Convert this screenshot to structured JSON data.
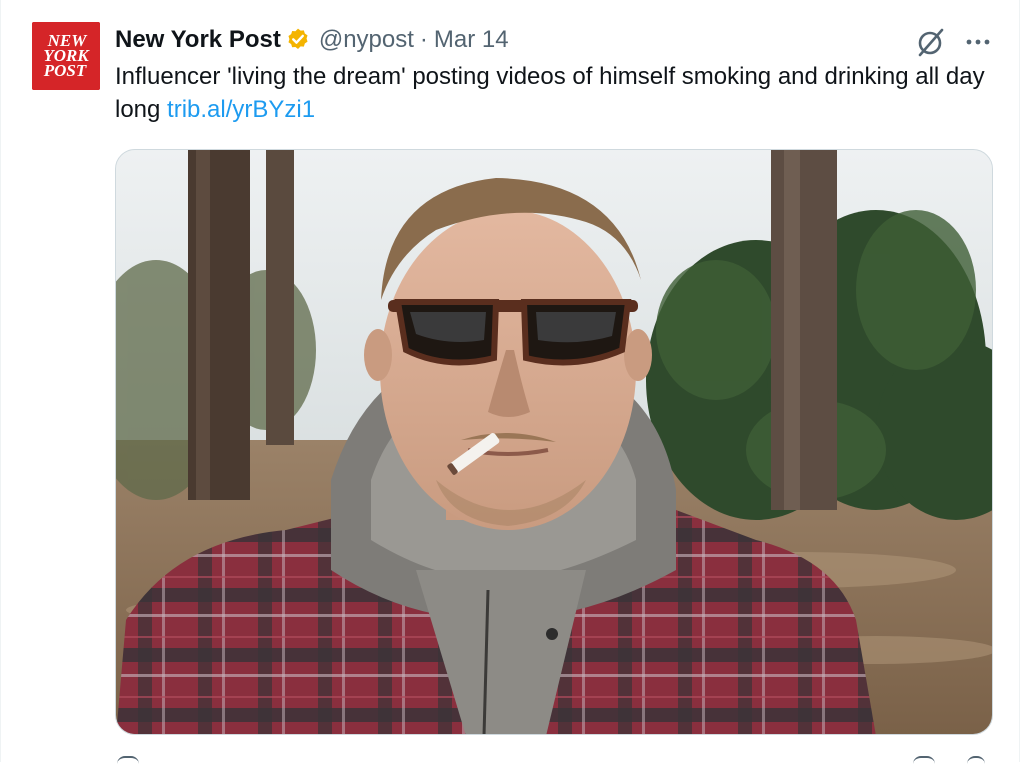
{
  "tweet": {
    "author": {
      "display_name": "New York Post",
      "handle": "@nypost",
      "verified": true,
      "verified_color": "#f4b400",
      "avatar_text": [
        "NEW",
        "YORK",
        "POST"
      ],
      "avatar_color": "#d52528"
    },
    "separator": "·",
    "date": "Mar 14",
    "text": "Influencer 'living the dream' posting videos of himself smoking and drinking all day long ",
    "link": "trib.al/yrBYzi1",
    "link_color": "#1d9bf0",
    "icons": {
      "grok": "grok-icon",
      "more": "more-icon",
      "verified": "verified-badge-icon"
    },
    "media": {
      "type": "photo"
    }
  }
}
